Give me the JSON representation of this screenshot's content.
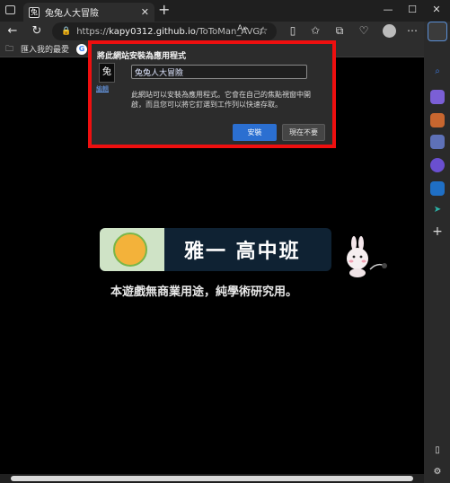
{
  "tab": {
    "title": "兔兔人大冒險",
    "favicon": "兔"
  },
  "address": {
    "scheme": "https://",
    "host": "kapy0312.github.io",
    "path": "/ToToMan_AVG/"
  },
  "favorites": {
    "import_label": "匯入我的最愛",
    "g_label": "G"
  },
  "popup": {
    "title": "將此網站安裝為應用程式",
    "app_icon_label": "編輯",
    "app_name": "兔兔人大冒險",
    "description": "此網站可以安裝為應用程式。它會在自己的焦點視窗中開啟，而且您可以將它釘選到工作列以快速存取。",
    "install_label": "安裝",
    "not_now_label": "現在不要"
  },
  "banner": {
    "title": "雅一 高中班",
    "subtitle": "本遊戲無商業用途，純學術研究用。"
  },
  "colors": {
    "accent": "#2b6fd1",
    "highlight_border": "#ee0f0f",
    "page_bg": "#000000"
  }
}
